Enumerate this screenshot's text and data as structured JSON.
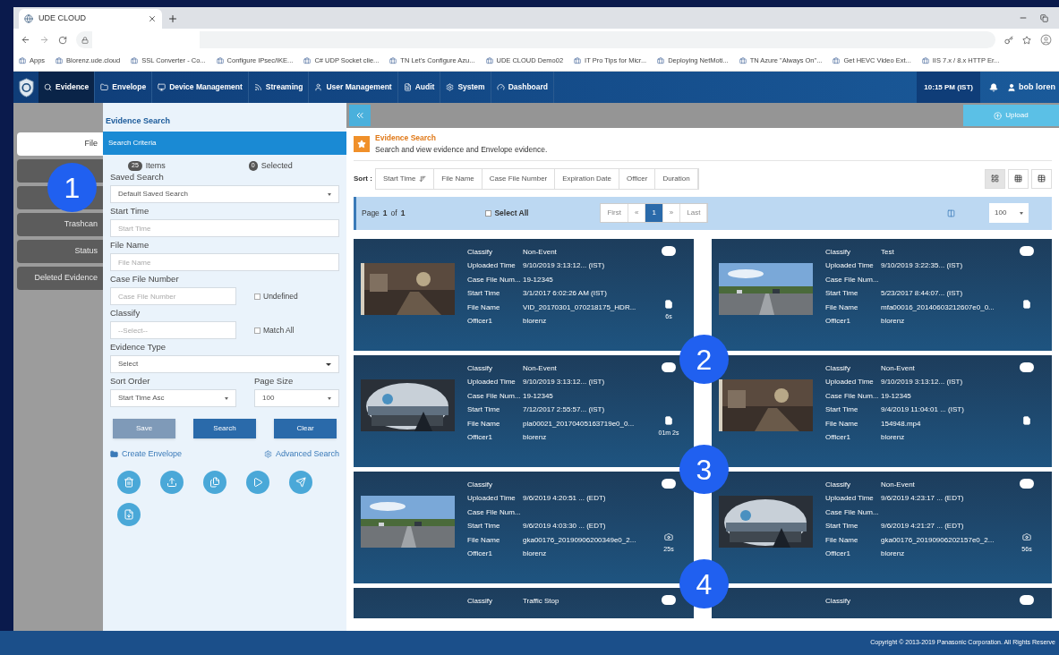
{
  "browser": {
    "tab_title": "UDE CLOUD",
    "bookmarks": [
      {
        "label": "Apps"
      },
      {
        "label": "Blorenz.ude.cloud"
      },
      {
        "label": "SSL Converter - Co..."
      },
      {
        "label": "Configure IPsec/IKE..."
      },
      {
        "label": "C# UDP Socket clie..."
      },
      {
        "label": "TN  Let's Configure Azu..."
      },
      {
        "label": "UDE CLOUD Demo02"
      },
      {
        "label": "IT Pro Tips for Micr..."
      },
      {
        "label": "Deploying NetMoti..."
      },
      {
        "label": "TN  Azure \"Always On\"..."
      },
      {
        "label": "Get HEVC Video Ext..."
      },
      {
        "label": "IIS 7.x / 8.x HTTP Er..."
      }
    ]
  },
  "nav": {
    "items": [
      {
        "label": "Evidence",
        "selected": true
      },
      {
        "label": "Envelope",
        "selected": false
      },
      {
        "label": "Device Management",
        "selected": false
      },
      {
        "label": "Streaming",
        "selected": false
      },
      {
        "label": "User Management",
        "selected": false
      },
      {
        "label": "Audit",
        "selected": false
      },
      {
        "label": "System",
        "selected": false
      },
      {
        "label": "Dashboard",
        "selected": false
      }
    ],
    "time": "10:15 PM (IST)",
    "user": "bob loren"
  },
  "sidebar": {
    "items": [
      {
        "label": "File",
        "selected": true
      },
      {
        "selected": false
      },
      {
        "selected": false
      },
      {
        "label": "Trashcan",
        "selected": false
      },
      {
        "label": "Status",
        "selected": false
      },
      {
        "label": "Deleted Evidence",
        "selected": false
      }
    ]
  },
  "search_panel": {
    "title": "Evidence Search",
    "section": "Search Criteria",
    "items_count": "25",
    "items_label": "Items",
    "selected_count": "0",
    "selected_label": "Selected",
    "saved_search": {
      "label": "Saved Search",
      "value": "Default Saved Search"
    },
    "start_time": {
      "label": "Start Time",
      "placeholder": "Start Time"
    },
    "file_name": {
      "label": "File Name",
      "placeholder": "File Name"
    },
    "case_file_number": {
      "label": "Case File Number",
      "placeholder": "Case File Number"
    },
    "undefined": {
      "label": "Undefined",
      "checked": false
    },
    "classify": {
      "label": "Classify",
      "placeholder": "--Select--"
    },
    "match_all": {
      "label": "Match All",
      "checked": false
    },
    "evidence_type": {
      "label": "Evidence Type",
      "value": "Select"
    },
    "sort_order": {
      "label": "Sort Order",
      "value": "Start Time Asc"
    },
    "page_size": {
      "label": "Page Size",
      "value": "100"
    },
    "buttons": [
      {
        "label": "Save",
        "disabled": true
      },
      {
        "label": "Search",
        "disabled": false
      },
      {
        "label": "Clear",
        "disabled": false
      }
    ],
    "links": [
      "Create Envelope",
      "Advanced Search"
    ]
  },
  "main": {
    "upload": "Upload",
    "title": "Evidence Search",
    "subtitle": "Search and view evidence and Envelope evidence.",
    "sort_label": "Sort :",
    "sort_columns": [
      {
        "label": "Start Time",
        "sorted": true
      },
      {
        "label": "File Name",
        "sorted": false
      },
      {
        "label": "Case File Number",
        "sorted": false
      },
      {
        "label": "Expiration Date",
        "sorted": false
      },
      {
        "label": "Officer",
        "sorted": false
      },
      {
        "label": "Duration",
        "sorted": false
      }
    ],
    "views": [
      {
        "selected": true
      },
      {
        "selected": false
      },
      {
        "selected": false
      }
    ],
    "page_label": "Page",
    "page": "1",
    "of_label": "of",
    "pages": "1",
    "select_all": {
      "label": "Select All",
      "checked": false
    },
    "pager": [
      {
        "label": "First",
        "selected": false
      },
      {
        "label": "«",
        "selected": false
      },
      {
        "label": "1",
        "selected": true
      },
      {
        "label": "»",
        "selected": false
      },
      {
        "label": "Last",
        "selected": false
      }
    ],
    "page_size": "100",
    "cards": [
      {
        "kind": "document",
        "duration": "6s",
        "fields": [
          {
            "label": "Classify",
            "value": "Non-Event"
          },
          {
            "label": "Uploaded Time",
            "value": "9/10/2019 3:13:12... (IST)"
          },
          {
            "label": "Case File Num...",
            "value": "19-12345"
          },
          {
            "label": "Start Time",
            "value": "3/1/2017 6:02:26 AM (IST)"
          },
          {
            "label": "File Name",
            "value": "VID_20170301_070218175_HDR..."
          },
          {
            "label": "Officer1",
            "value": "blorenz"
          }
        ]
      },
      {
        "kind": "document",
        "fields": [
          {
            "label": "Classify",
            "value": "Test"
          },
          {
            "label": "Uploaded Time",
            "value": "9/10/2019 3:22:35... (IST)"
          },
          {
            "label": "Case File Num..."
          },
          {
            "label": "Start Time",
            "value": "5/23/2017 8:44:07... (IST)"
          },
          {
            "label": "File Name",
            "value": "mfa00016_20140603212607e0_0..."
          },
          {
            "label": "Officer1",
            "value": "blorenz"
          }
        ]
      },
      {
        "kind": "document",
        "duration": "01m 2s",
        "fields": [
          {
            "label": "Classify",
            "value": "Non-Event"
          },
          {
            "label": "Uploaded Time",
            "value": "9/10/2019 3:13:12... (IST)"
          },
          {
            "label": "Case File Num...",
            "value": "19-12345"
          },
          {
            "label": "Start Time",
            "value": "7/12/2017 2:55:57... (IST)"
          },
          {
            "label": "File Name",
            "value": "pla00021_20170405163719e0_0..."
          },
          {
            "label": "Officer1",
            "value": "blorenz"
          }
        ]
      },
      {
        "kind": "document",
        "fields": [
          {
            "label": "Classify",
            "value": "Non-Event"
          },
          {
            "label": "Uploaded Time",
            "value": "9/10/2019 3:13:12... (IST)"
          },
          {
            "label": "Case File Num...",
            "value": "19-12345"
          },
          {
            "label": "Start Time",
            "value": "9/4/2019 11:04:01 ... (IST)"
          },
          {
            "label": "File Name",
            "value": "154948.mp4"
          },
          {
            "label": "Officer1",
            "value": "blorenz"
          }
        ]
      },
      {
        "kind": "camera",
        "duration": "25s",
        "fields": [
          {
            "label": "Classify"
          },
          {
            "label": "Uploaded Time",
            "value": "9/6/2019 4:20:51 ... (EDT)"
          },
          {
            "label": "Case File Num..."
          },
          {
            "label": "Start Time",
            "value": "9/6/2019 4:03:30 ... (EDT)"
          },
          {
            "label": "File Name",
            "value": "gka00176_20190906200349e0_2..."
          },
          {
            "label": "Officer1",
            "value": "blorenz"
          }
        ]
      },
      {
        "kind": "camera",
        "duration": "56s",
        "fields": [
          {
            "label": "Classify",
            "value": "Non-Event"
          },
          {
            "label": "Uploaded Time",
            "value": "9/6/2019 4:23:17 ... (EDT)"
          },
          {
            "label": "Case File Num..."
          },
          {
            "label": "Start Time",
            "value": "9/6/2019 4:21:27 ... (EDT)"
          },
          {
            "label": "File Name",
            "value": "gka00176_20190906202157e0_2..."
          },
          {
            "label": "Officer1",
            "value": "blorenz"
          }
        ]
      },
      {
        "kind": "partial",
        "fields": [
          {
            "label": "Classify",
            "value": "Traffic Stop"
          }
        ]
      },
      {
        "kind": "partial",
        "fields": [
          {
            "label": "Classify"
          }
        ]
      }
    ]
  },
  "footer": {
    "copyright": "Copyright © 2013-2019 Panasonic Corporation. All Rights Reserve"
  },
  "callouts": [
    "1",
    "2",
    "3",
    "4"
  ]
}
